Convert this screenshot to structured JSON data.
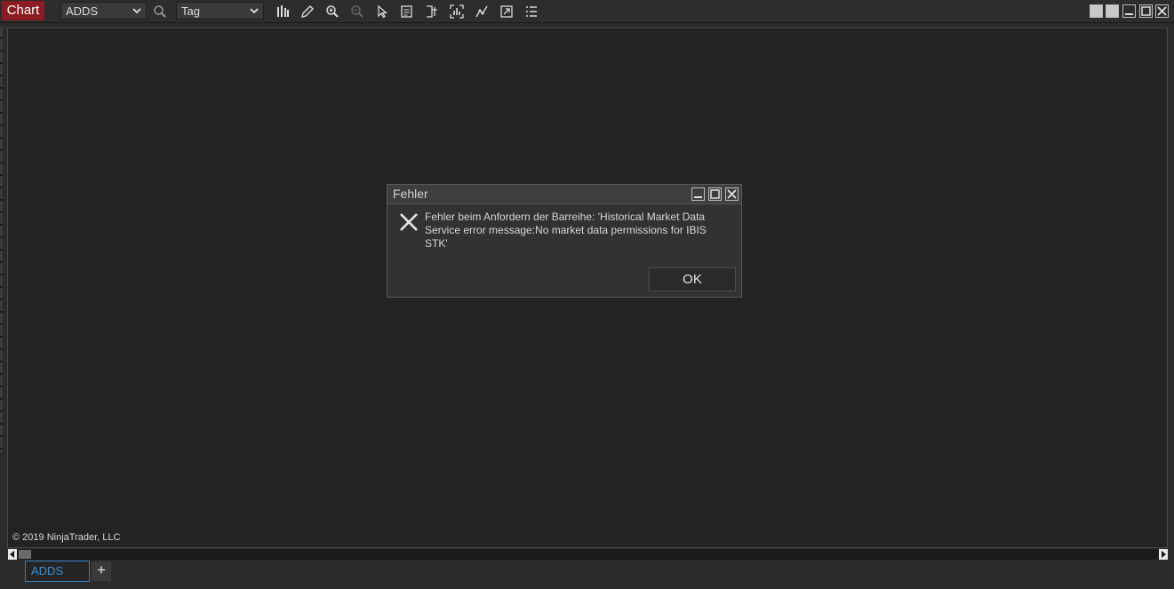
{
  "toolbar": {
    "chart_tab": "Chart",
    "instrument": "ADDS",
    "interval": "Tag",
    "icons": [
      "search-icon",
      "bars-icon",
      "pencil-icon",
      "zoom-in-icon",
      "zoom-out-icon",
      "pointer-icon",
      "properties-icon",
      "bracket-icon",
      "indicators-icon",
      "strategy-icon",
      "share-icon",
      "list-icon"
    ],
    "window_buttons": [
      "tile-icon",
      "tile-icon",
      "minimize-icon",
      "maximize-icon",
      "close-icon"
    ]
  },
  "chart": {
    "copyright": "© 2019 NinjaTrader, LLC"
  },
  "bottom_tabs": {
    "active_tab": "ADDS",
    "add_label": "+"
  },
  "dialog": {
    "title": "Fehler",
    "message": "Fehler beim Anfordern der Barreihe: 'Historical Market Data Service error message:No market data permissions for IBIS STK'",
    "ok_label": "OK",
    "icon": "error-x-icon"
  },
  "colors": {
    "accent_red": "#8a1c22",
    "active_tab_blue": "#3d8fd6",
    "chart_background": "#232323"
  }
}
